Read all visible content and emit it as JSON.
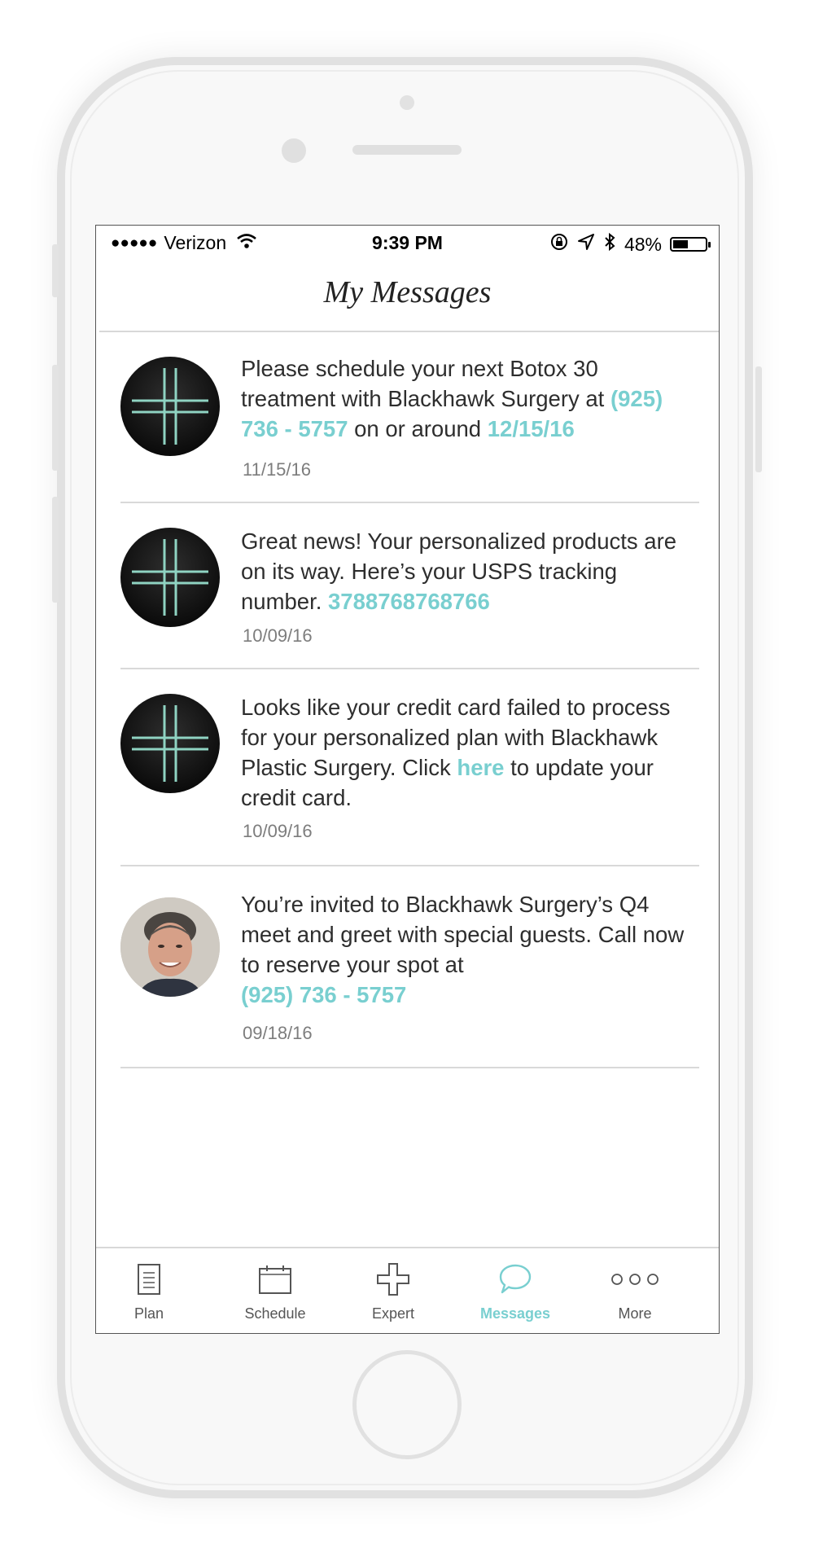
{
  "status_bar": {
    "signal_dots": "●●●●●",
    "carrier": "Verizon",
    "time": "9:39 PM",
    "battery_percent": "48%",
    "battery_level": 0.48
  },
  "header": {
    "title": "My Messages"
  },
  "colors": {
    "accent": "#79cfd0",
    "text": "#2e2e2e",
    "date": "#7d7d7d"
  },
  "messages": [
    {
      "avatar": "clinic-cross-logo",
      "text_parts": [
        "Please schedule your next Botox 30 treatment with Blackhawk Surgery at ",
        "(925) 736 - 5757",
        " on or around ",
        "12/15/16"
      ],
      "date": "11/15/16"
    },
    {
      "avatar": "clinic-cross-logo",
      "text_parts": [
        "Great news! Your personalized products are on its way. Here’s your USPS tracking number. ",
        "3788768768766"
      ],
      "date": "10/09/16"
    },
    {
      "avatar": "clinic-cross-logo",
      "text_parts": [
        "Looks like your credit card failed to process for your personalized plan with Blackhawk Plastic Surgery. Click ",
        "here",
        " to update your credit card."
      ],
      "date": "10/09/16"
    },
    {
      "avatar": "doctor-photo",
      "text_parts": [
        "You’re invited to Blackhawk Surgery’s Q4 meet and greet with special guests. Call now to reserve your spot at ",
        "(925) 736 - 5757"
      ],
      "date": "09/18/16"
    }
  ],
  "tabs": [
    {
      "label": "Plan",
      "icon": "document-icon",
      "active": false
    },
    {
      "label": "Schedule",
      "icon": "calendar-icon",
      "active": false
    },
    {
      "label": "Expert",
      "icon": "cross-icon",
      "active": false
    },
    {
      "label": "Messages",
      "icon": "chat-bubble-icon",
      "active": true
    },
    {
      "label": "More",
      "icon": "more-dots-icon",
      "active": false
    }
  ]
}
